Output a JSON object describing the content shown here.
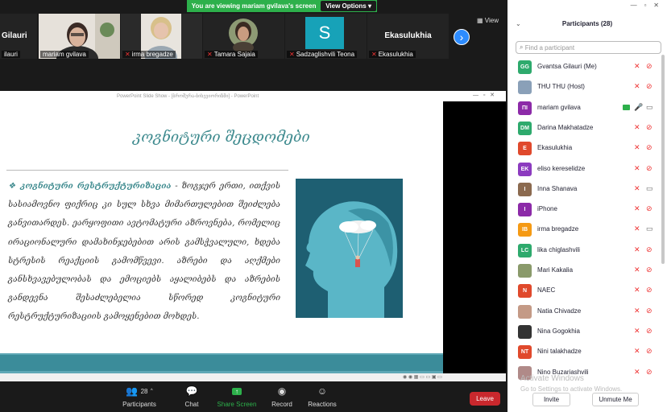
{
  "banner": {
    "message": "You are viewing mariam gvilava's screen",
    "options_label": "View Options"
  },
  "gallery": {
    "view_label": "View",
    "tiles": [
      {
        "big_text": "Gilauri",
        "caption": "ilauri",
        "muted": false
      },
      {
        "caption": "mariam gvilava",
        "muted": false
      },
      {
        "caption": "irma bregadze",
        "muted": true
      },
      {
        "caption": "Tamara Sajaia",
        "muted": true
      },
      {
        "initial": "S",
        "caption": "Sadzaglishvili Teona",
        "muted": true,
        "color": "#17a2b8"
      },
      {
        "big_text": "Ekasulukhia",
        "caption": "Ekasulukhia",
        "muted": true
      }
    ]
  },
  "ppt": {
    "titlebar": "PowerPoint Slide Show - [ბროშურა-ბიხევიორიზმი] - PowerPoint"
  },
  "slide": {
    "title": "კოგნიტური შეცდომები",
    "bullet_lead": "კოგნიტური რესტრუქტურიზაცია",
    "bullet_text": " - ზოგჯერ ერთი, ითქვის სასიამოვნო ფიქრიც კი სულ სხვა მიმართულებით შეიძლება განვითარდეს. ეარყოფითი ავტომატური აზროვნება, რომელიც ირაციონალური დამახინჯებებით არის გამსჭვალული, ხდება სტრესის რეაქციის გამომწვევი. აზრები და აღქმები განსხვავებულობას და ემოციებს აყალიბებს და აზრების განდევნა შესაძლებელია სწორედ კოგნიტური რესტრუქტურიზაციის გამოყენებით მოხდეს."
  },
  "toolbar": {
    "participants_label": "Participants",
    "participants_count": "28",
    "chat_label": "Chat",
    "share_label": "Share Screen",
    "record_label": "Record",
    "reactions_label": "Reactions",
    "leave_label": "Leave"
  },
  "panel": {
    "title": "Participants (28)",
    "search_placeholder": "Find a participant",
    "invite_label": "Invite",
    "unmute_label": "Unmute Me",
    "watermark_1": "Activate Windows",
    "watermark_2": "Go to Settings to activate Windows.",
    "participants": [
      {
        "initials": "GG",
        "name": "Gvantsa Gilauri (Me)",
        "color": "#2eaa6d",
        "video": false
      },
      {
        "initials": "",
        "name": "THU THU (Host)",
        "color": "#8aa0b8",
        "video": false
      },
      {
        "initials": "ΠΙ",
        "name": "mariam gvilava",
        "color": "#8c2aa8",
        "video": true,
        "mic_on": true,
        "share": true
      },
      {
        "initials": "DM",
        "name": "Darina Makhatadze",
        "color": "#2eaa6d",
        "video": false
      },
      {
        "initials": "E",
        "name": "Ekasulukhia",
        "color": "#e0492c",
        "video": false
      },
      {
        "initials": "EK",
        "name": "eliso kereselidze",
        "color": "#8c3bbf",
        "video": false
      },
      {
        "initials": "I",
        "name": "Inna Shanava",
        "color": "#8b6a4f",
        "video": true
      },
      {
        "initials": "I",
        "name": "iPhone",
        "color": "#8c2aa8",
        "video": false
      },
      {
        "initials": "IB",
        "name": "irma bregadze",
        "color": "#f59a14",
        "video": true
      },
      {
        "initials": "LC",
        "name": "lika chiglashvili",
        "color": "#2eaa6d",
        "video": false
      },
      {
        "initials": "",
        "name": "Mari Kakalia",
        "color": "#8a9a6b",
        "video": false
      },
      {
        "initials": "N",
        "name": "NAEC",
        "color": "#e0492c",
        "video": false
      },
      {
        "initials": "",
        "name": "Natia Chivadze",
        "color": "#c49a86",
        "video": false
      },
      {
        "initials": "",
        "name": "Nina Gogokhia",
        "color": "#333333",
        "video": false
      },
      {
        "initials": "NT",
        "name": "Nini talakhadze",
        "color": "#e0492c",
        "video": false
      },
      {
        "initials": "",
        "name": "Nino Buzariashvili",
        "color": "#b08a88",
        "video": false
      }
    ]
  }
}
